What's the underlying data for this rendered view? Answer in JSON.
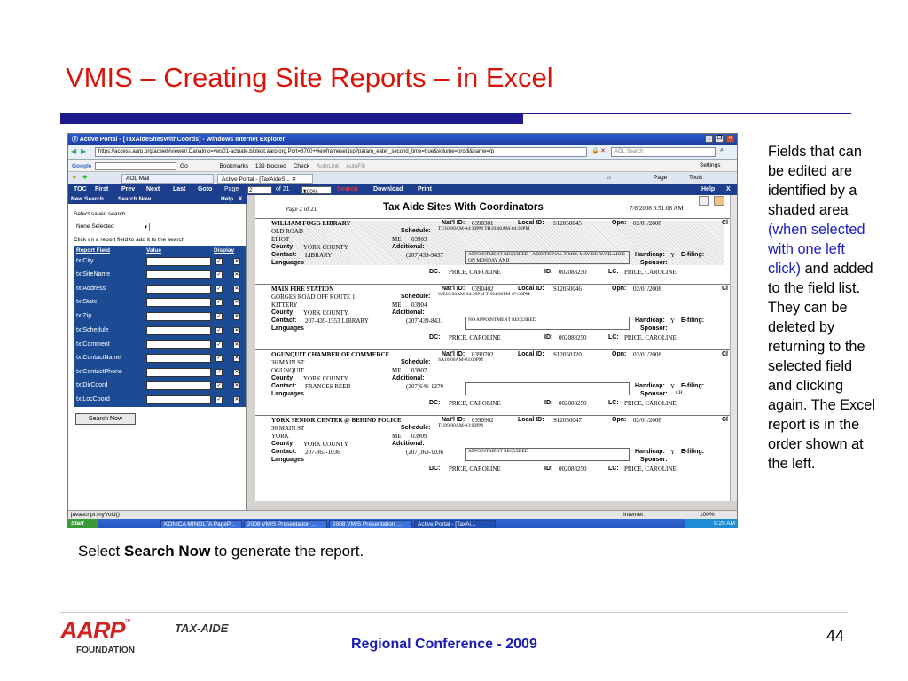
{
  "slide": {
    "title": "VMIS – Creating Site Reports – in Excel",
    "side_text_a": "Fields that can be edited are identified by a shaded area ",
    "side_text_blue": "(when selected with one left click)",
    "side_text_b": " and added to the field list. They can be deleted by returning to the selected field and clicking again. The Excel report is in the order shown at the left.",
    "caption_pre": "Select ",
    "caption_bold": "Search Now",
    "caption_post": " to generate the report.",
    "footer_conference": "Regional Conference - 2009",
    "page_number": "44",
    "logo_aarp": "AARP",
    "logo_tm": "™",
    "logo_taxaide": "TAX-AIDE",
    "logo_foundation": "FOUNDATION",
    "colors": {
      "title": "#d9150a",
      "accent_bar": "#1e1b8c",
      "highlight": "#1c1cc2",
      "footer_text": "#1c1cb4"
    }
  },
  "browser": {
    "window_title": "Active Portal - [TaxAideSitesWithCoords] - Windows Internet Explorer",
    "address": "https://access.aarp.org/acweb/viewer/,DanaInfo=vws01-actuate.biptest.aarp.org,Port=8700+viewframeset.jsp?param_eater_second_time=true&volume=prodi&name=/p",
    "search_placeholder": "AOL Search",
    "google_label": "Google",
    "google_go": "Go",
    "bookmarks": "Bookmarks",
    "blocked": "139 blocked",
    "check": "Check",
    "autolink": "AutoLink",
    "autofill": "AutoFill",
    "settings": "Settings",
    "tab1": "AOL Mail",
    "tab2": "Active Portal - [TaxAideS...",
    "page_menu": "Page",
    "tools_menu": "Tools",
    "status_text": "javascript:myVoid()",
    "status_zone": "Internet",
    "status_zoom": "100%"
  },
  "report_nav": {
    "toc": "TOC",
    "first": "First",
    "prev": "Prev",
    "next": "Next",
    "last": "Last",
    "goto": "Goto",
    "page_label": "Page",
    "page_value": "2",
    "of_total": "of 21",
    "zoom": "100%",
    "search": "Search",
    "download": "Download",
    "print": "Print",
    "help": "Help",
    "close": "X"
  },
  "left_panel": {
    "header_new_search": "New Search",
    "header_search_now": "Search Now",
    "header_help": "Help",
    "header_close": "X",
    "select_saved": "Select saved search",
    "saved_value": "None Selected",
    "instruction": "Click on a report field to add it to the search",
    "col_field": "Report Field",
    "col_value": "Value",
    "col_display": "Display",
    "fields": [
      "txtCity",
      "txtSiteName",
      "txtAddress",
      "txtState",
      "txtZip",
      "txtSchedule",
      "txtComment",
      "txtContactName",
      "txtContactPhone",
      "txtDirCoord",
      "txtLocCoord"
    ],
    "search_button": "Search Now"
  },
  "report": {
    "page_of": "Page 2 of 21",
    "heading": "Tax Aide Sites With Coordinators",
    "date": "7/8/2008 6:51:08 AM",
    "lbl_natl": "Nat'l ID:",
    "lbl_local": "Local ID:",
    "lbl_opn": "Opn:",
    "lbl_cl": "Cl",
    "lbl_schedule": "Schedule:",
    "lbl_county": "County",
    "lbl_additional": "Additional:",
    "lbl_contact": "Contact:",
    "lbl_languages": "Languages",
    "lbl_handicap": "Handicap:",
    "lbl_efiling": "E-filing:",
    "lbl_sponsor": "Sponsor:",
    "lbl_dc": "DC:",
    "lbl_id": "ID:",
    "lbl_lc": "LC:",
    "records": [
      {
        "name": "WILLIAM FOGG LIBRARY",
        "natl": "0390301",
        "local": "S12050045",
        "opn": "02/01/2008",
        "addr": "OLD ROAD",
        "city": "ELIOT",
        "state": "ME",
        "zip": "03903",
        "schedule": "TU10:00AM-04:30PM TH10:00AM-04:30PM",
        "county": "YORK COUNTY",
        "contact": "LIBRARY",
        "phone": "(207)439-9437",
        "comment": "APPOINTMENT REQUIRED - ADDITIONAL TIMES MAY BE AVAILABLE ON MONDAY AND",
        "handicap": "Y",
        "sponsor": "",
        "dc": "PRICE, CAROLINE",
        "id": "002088250",
        "lc": "PRICE, CAROLINE"
      },
      {
        "name": "MAIN FIRE STATION",
        "natl": "0390402",
        "local": "S12050046",
        "opn": "02/01/2008",
        "addr": "GORGES ROAD OFF ROUTE 1",
        "city": "KITTERY",
        "state": "ME",
        "zip": "03904",
        "schedule": "WE10:00AM-04:30PM TH04:00PM-07:30PM",
        "county": "YORK COUNTY",
        "contact": "207-439-1553 LIBRARY",
        "phone": "(207)439-8431",
        "comment": "NO APPOINTMENT REQUIRED",
        "handicap": "Y",
        "sponsor": "",
        "dc": "PRICE, CAROLINE",
        "id": "002088250",
        "lc": "PRICE, CAROLINE"
      },
      {
        "name": "OGUNQUIT CHAMBER OF COMMERCE",
        "natl": "0390702",
        "local": "S12050120",
        "opn": "02/01/2008",
        "addr": "36 MAIN ST",
        "city": "OGUNQUIT",
        "state": "ME",
        "zip": "03907",
        "schedule": "SA10:00AM-03:00PM",
        "county": "YORK COUNTY",
        "contact": "FRANCES REED",
        "phone": "(207)646-1279",
        "comment": "",
        "handicap": "Y",
        "sponsor": "CH",
        "dc": "PRICE, CAROLINE",
        "id": "002088250",
        "lc": "PRICE, CAROLINE"
      },
      {
        "name": "YORK SENIOR CENTER @ BEHIND POLICE",
        "natl": "0390902",
        "local": "S12050047",
        "opn": "02/01/2008",
        "addr": "36 MAIN ST",
        "city": "YORK",
        "state": "ME",
        "zip": "03909",
        "schedule": "TU09:00AM-03:00PM",
        "county": "YORK COUNTY",
        "contact": "207-363-1036",
        "phone": "(207)363-1036",
        "comment": "APPOINTMENT REQUIRED",
        "handicap": "Y",
        "sponsor": "",
        "dc": "PRICE, CAROLINE",
        "id": "002088250",
        "lc": "PRICE, CAROLINE"
      }
    ]
  },
  "taskbar": {
    "start": "Start",
    "items": [
      "KONICA MINOLTA PageP...",
      "2008 VMIS Presentation ...",
      "2008 VMIS Presentation ...",
      "Active Portal - [TaxAi..."
    ],
    "clock": "8:29 AM"
  }
}
